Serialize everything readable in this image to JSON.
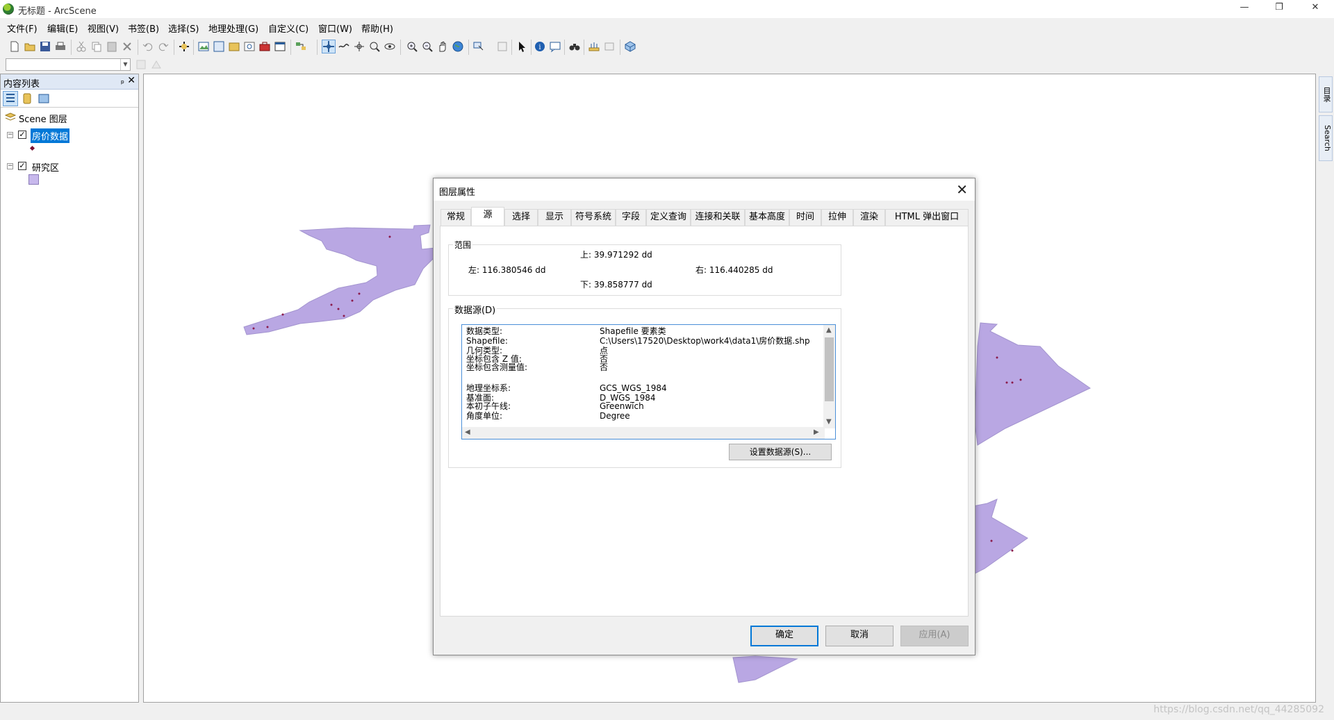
{
  "window": {
    "title": "无标题 - ArcScene",
    "controls": {
      "minimize": "—",
      "restore": "❐",
      "close": "✕"
    }
  },
  "menu": [
    "文件(F)",
    "编辑(E)",
    "视图(V)",
    "书签(B)",
    "选择(S)",
    "地理处理(G)",
    "自定义(C)",
    "窗口(W)",
    "帮助(H)"
  ],
  "toc": {
    "title": "内容列表",
    "pin": "ₚ",
    "close": "✕",
    "scene_label": "Scene 图层",
    "layers": [
      {
        "name": "房价数据",
        "checked": "✓",
        "expander": "−",
        "selected": true,
        "symbol": "point",
        "symbol_color": "#7b1130"
      },
      {
        "name": "研究区",
        "checked": "✓",
        "expander": "−",
        "selected": false,
        "symbol": "polygon",
        "symbol_color": "#c7b8ec"
      }
    ]
  },
  "right_dock": {
    "tabs": [
      "目录",
      "Search"
    ]
  },
  "status": {
    "watermark": "https://blog.csdn.net/qq_44285092"
  },
  "map": {
    "fill_color": "#b9a7e3",
    "point_color": "#8b1a4a"
  },
  "dialog": {
    "title": "图层属性",
    "close": "✕",
    "tabs": [
      "常规",
      "源",
      "选择",
      "显示",
      "符号系统",
      "字段",
      "定义查询",
      "连接和关联",
      "基本高度",
      "时间",
      "拉伸",
      "渲染",
      "HTML 弹出窗口"
    ],
    "active_tab": "源",
    "extent": {
      "legend": "范围",
      "top": "上:  39.971292 dd",
      "left": "左: 116.380546 dd",
      "right": "右:  116.440285 dd",
      "bottom": "下:  39.858777 dd"
    },
    "datasource": {
      "legend": "数据源(D)",
      "rows": [
        {
          "key": "数据类型:",
          "value": "Shapefile 要素类"
        },
        {
          "key": "Shapefile:",
          "value": "C:\\Users\\17520\\Desktop\\work4\\data1\\房价数据.shp"
        },
        {
          "key": "几何类型:",
          "value": "点"
        },
        {
          "key": "坐标包含 Z 值:",
          "value": "否"
        },
        {
          "key": "坐标包含测量值:",
          "value": "否"
        },
        {
          "key": "",
          "value": ""
        },
        {
          "key": "地理坐标系:",
          "value": "GCS_WGS_1984"
        },
        {
          "key": "基准面:",
          "value": "D_WGS_1984"
        },
        {
          "key": "本初子午线:",
          "value": "Greenwich"
        },
        {
          "key": "角度单位:",
          "value": "Degree"
        }
      ],
      "set_source_button": "设置数据源(S)..."
    },
    "buttons": {
      "ok": "确定",
      "cancel": "取消",
      "apply": "应用(A)"
    }
  }
}
